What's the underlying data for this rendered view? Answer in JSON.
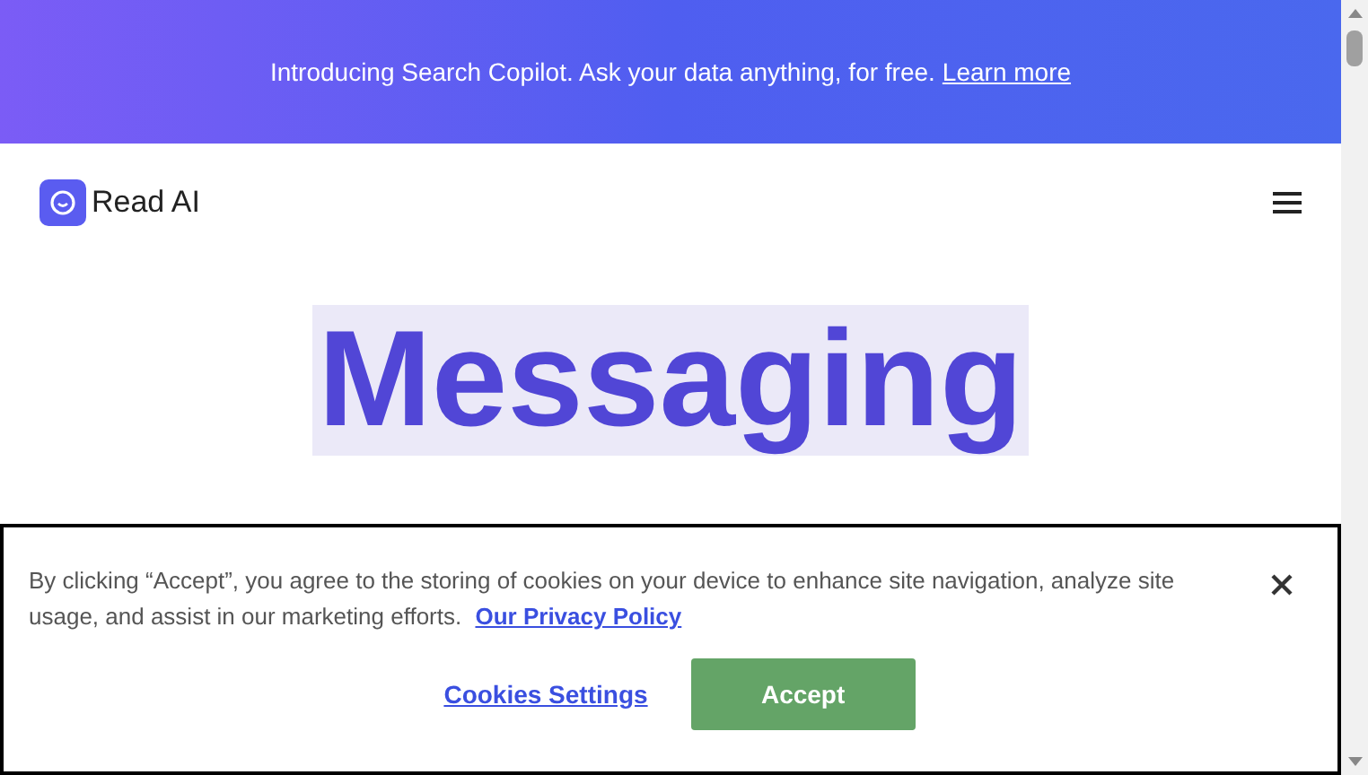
{
  "announcement": {
    "text": "Introducing Search Copilot. Ask your data anything, for free.",
    "link": "Learn more"
  },
  "header": {
    "brand": "Read AI"
  },
  "hero": {
    "highlighted_title": "Messaging"
  },
  "cookie_banner": {
    "text": "By clicking “Accept”, you agree to the storing of cookies on your device to enhance site navigation, analyze site usage, and assist in our marketing efforts.",
    "policy_link": "Our Privacy Policy",
    "settings_link": "Cookies Settings",
    "accept_button": "Accept"
  }
}
